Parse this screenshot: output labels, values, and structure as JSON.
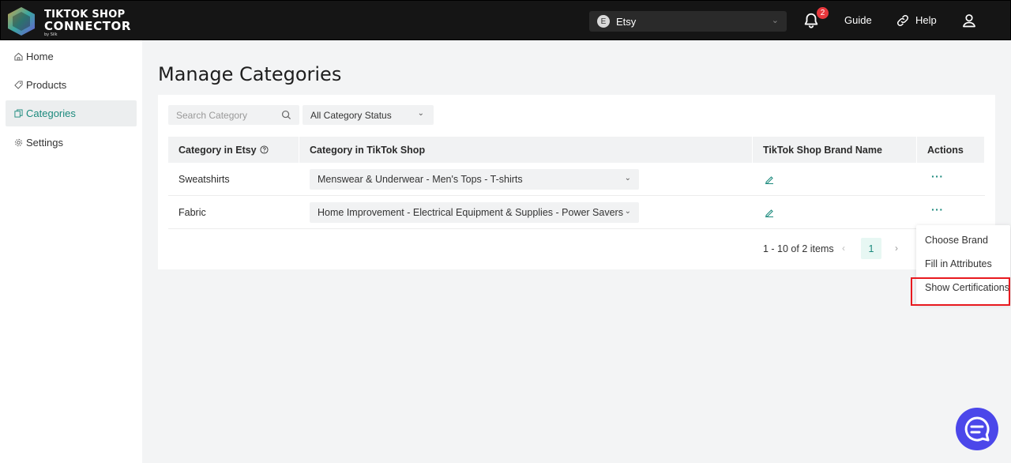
{
  "brand": {
    "line1": "TIKTOK SHOP",
    "line2": "CONNECTOR",
    "line3": "by Silk"
  },
  "topbar": {
    "store_initial": "E",
    "store_name": "Etsy",
    "notification_count": "2",
    "guide_label": "Guide",
    "help_label": "Help"
  },
  "sidebar": {
    "items": [
      {
        "label": "Home"
      },
      {
        "label": "Products"
      },
      {
        "label": "Categories"
      },
      {
        "label": "Settings"
      }
    ]
  },
  "main": {
    "title": "Manage Categories",
    "search_placeholder": "Search Category",
    "status_filter": "All Category Status",
    "columns": [
      "Category in Etsy",
      "Category in TikTok Shop",
      "TikTok Shop Brand Name",
      "Actions"
    ],
    "rows": [
      {
        "etsy": "Sweatshirts",
        "tiktok": "Menswear & Underwear - Men's Tops - T-shirts"
      },
      {
        "etsy": "Fabric",
        "tiktok": "Home Improvement - Electrical Equipment & Supplies - Power Savers"
      }
    ],
    "pagination": {
      "summary": "1 - 10 of 2 items",
      "current_page": "1"
    }
  },
  "actions_menu": {
    "items": [
      "Choose Brand",
      "Fill in Attributes",
      "Show Certifications"
    ]
  },
  "colors": {
    "accent": "#1c8a7d",
    "topbar": "#151515",
    "highlight": "#e8191f",
    "chat": "#4b47ea"
  }
}
